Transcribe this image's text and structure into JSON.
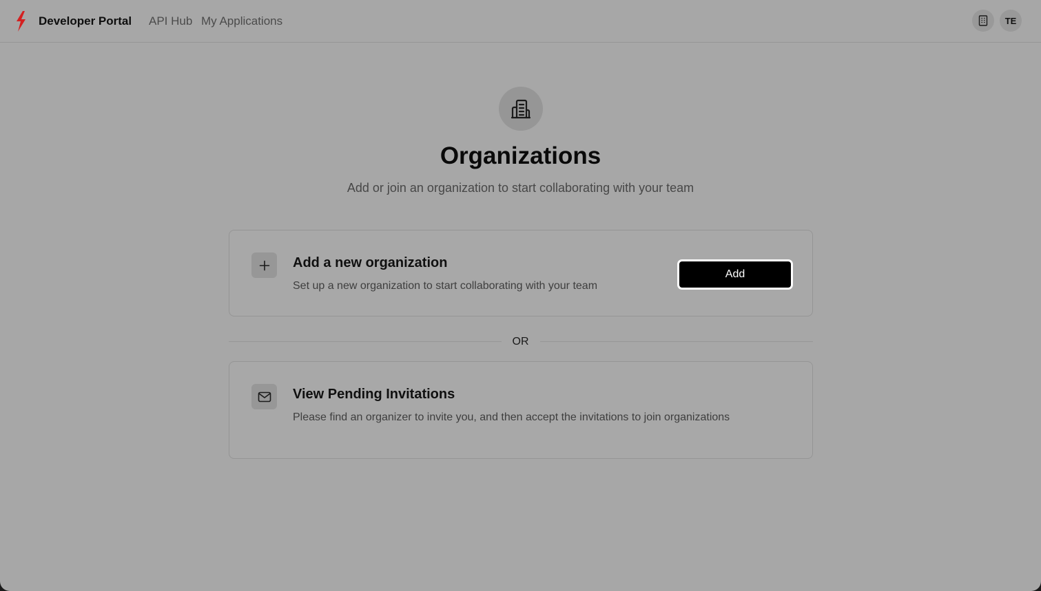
{
  "header": {
    "brand": "Developer Portal",
    "nav": [
      {
        "label": "API Hub"
      },
      {
        "label": "My Applications"
      }
    ],
    "avatar_initials": "TE"
  },
  "hero": {
    "title": "Organizations",
    "subtitle": "Add or join an organization to start collaborating with your team"
  },
  "add_card": {
    "title": "Add a new organization",
    "description": "Set up a new organization to start collaborating with your team",
    "button_label": "Add"
  },
  "divider_label": "OR",
  "invite_card": {
    "title": "View Pending Invitations",
    "description": "Please find an organizer to invite you, and then accept the invitations to join organizations"
  },
  "icons": {
    "logo": "lightning-bolt-icon",
    "org": "building-icon",
    "plus": "plus-icon",
    "mail": "mail-icon"
  },
  "colors": {
    "brand_accent": "#d42020",
    "primary_button": "#000000"
  }
}
